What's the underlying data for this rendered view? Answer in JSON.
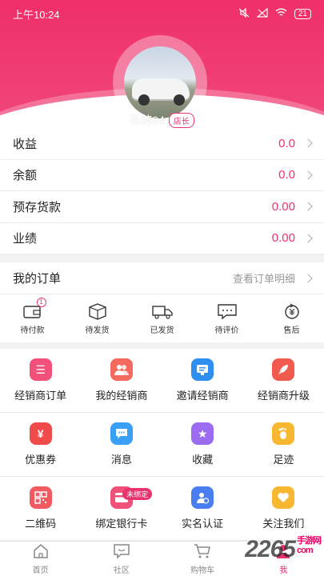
{
  "status_bar": {
    "time": "上午10:24",
    "battery": "21"
  },
  "profile": {
    "username": "系统04",
    "role": "店长"
  },
  "stats": [
    {
      "label": "收益",
      "value": "0.0"
    },
    {
      "label": "余额",
      "value": "0.0"
    },
    {
      "label": "预存货款",
      "value": "0.00"
    },
    {
      "label": "业绩",
      "value": "0.00"
    }
  ],
  "orders": {
    "title": "我的订单",
    "link": "查看订单明细",
    "items": [
      {
        "label": "待付款",
        "icon": "wallet-icon",
        "badge": "1"
      },
      {
        "label": "待发货",
        "icon": "box-icon"
      },
      {
        "label": "已发货",
        "icon": "truck-icon"
      },
      {
        "label": "待评价",
        "icon": "comment-icon"
      },
      {
        "label": "售后",
        "icon": "refund-icon"
      }
    ]
  },
  "grid": [
    [
      {
        "label": "经销商订单",
        "icon": "order-list-icon",
        "color": "#f0507a"
      },
      {
        "label": "我的经销商",
        "icon": "people-icon",
        "color": "#f46a5e"
      },
      {
        "label": "邀请经销商",
        "icon": "invite-icon",
        "color": "#2f8ff0"
      },
      {
        "label": "经销商升级",
        "icon": "rocket-icon",
        "color": "#f25a4e"
      }
    ],
    [
      {
        "label": "优惠券",
        "icon": "coupon-icon",
        "color": "#ef4b4b"
      },
      {
        "label": "消息",
        "icon": "message-icon",
        "color": "#3aa0f5"
      },
      {
        "label": "收藏",
        "icon": "star-icon",
        "color": "#9b6cf0"
      },
      {
        "label": "足迹",
        "icon": "footprint-icon",
        "color": "#f7b731"
      }
    ],
    [
      {
        "label": "二维码",
        "icon": "qrcode-icon",
        "color": "#f05a60"
      },
      {
        "label": "绑定银行卡",
        "icon": "bank-card-icon",
        "color": "#f0507a",
        "tag": "未绑定"
      },
      {
        "label": "实名认证",
        "icon": "id-verify-icon",
        "color": "#4a7ef0"
      },
      {
        "label": "关注我们",
        "icon": "follow-icon",
        "color": "#f7b731"
      }
    ]
  ],
  "tabbar": [
    {
      "label": "首页",
      "icon": "home-icon"
    },
    {
      "label": "社区",
      "icon": "community-icon"
    },
    {
      "label": "购物车",
      "icon": "cart-icon"
    },
    {
      "label": "我",
      "icon": "user-icon",
      "active": true
    }
  ],
  "watermark": {
    "brand": "2265",
    "sub_top": "手游网",
    "sub_bottom": "com"
  },
  "colors": {
    "accent": "#e8336d",
    "header": "#ef2f6a"
  }
}
